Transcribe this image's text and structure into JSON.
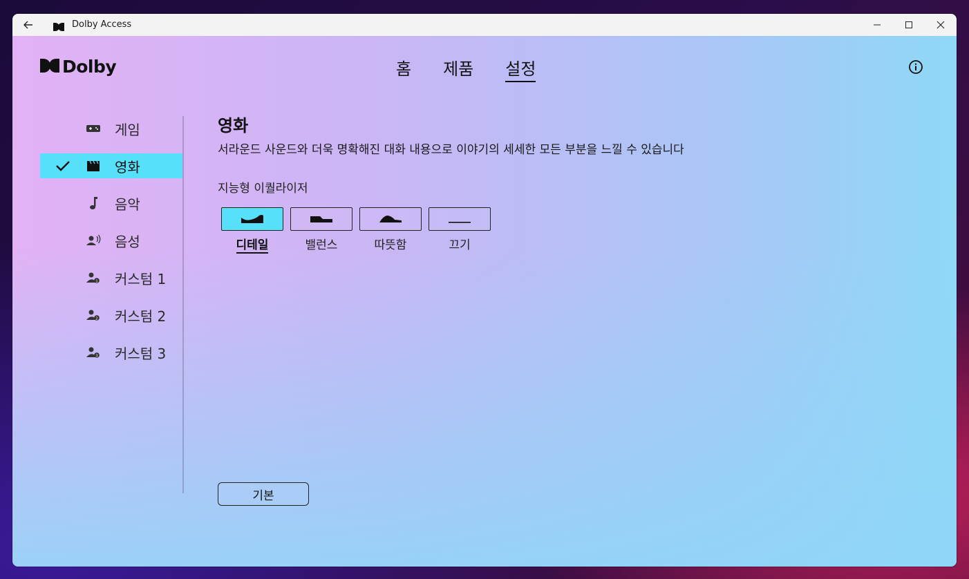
{
  "window": {
    "title": "Dolby Access"
  },
  "brand": {
    "name": "Dolby"
  },
  "topnav": [
    {
      "label": "홈",
      "active": false
    },
    {
      "label": "제품",
      "active": false
    },
    {
      "label": "설정",
      "active": true
    }
  ],
  "sidebar": {
    "items": [
      {
        "label": "게임",
        "icon": "gamepad-icon",
        "active": false
      },
      {
        "label": "영화",
        "icon": "clapperboard-icon",
        "active": true
      },
      {
        "label": "음악",
        "icon": "music-note-icon",
        "active": false
      },
      {
        "label": "음성",
        "icon": "voice-icon",
        "active": false
      },
      {
        "label": "커스텀 1",
        "icon": "custom-profile-1-icon",
        "active": false
      },
      {
        "label": "커스텀 2",
        "icon": "custom-profile-2-icon",
        "active": false
      },
      {
        "label": "커스텀 3",
        "icon": "custom-profile-3-icon",
        "active": false
      }
    ]
  },
  "content": {
    "title": "영화",
    "description": "서라운드 사운드와 더욱 명확해진 대화 내용으로 이야기의 세세한 모든 부분을 느낄 수 있습니다",
    "equalizer": {
      "label": "지능형 이퀄라이저",
      "options": [
        {
          "label": "디테일",
          "icon": "detailed-curve-icon",
          "active": true
        },
        {
          "label": "밸런스",
          "icon": "balanced-curve-icon",
          "active": false
        },
        {
          "label": "따뜻함",
          "icon": "warm-curve-icon",
          "active": false
        },
        {
          "label": "끄기",
          "icon": "flat-line-icon",
          "active": false
        }
      ]
    },
    "default_button": "기본"
  },
  "colors": {
    "accent": "#56e0f9"
  }
}
